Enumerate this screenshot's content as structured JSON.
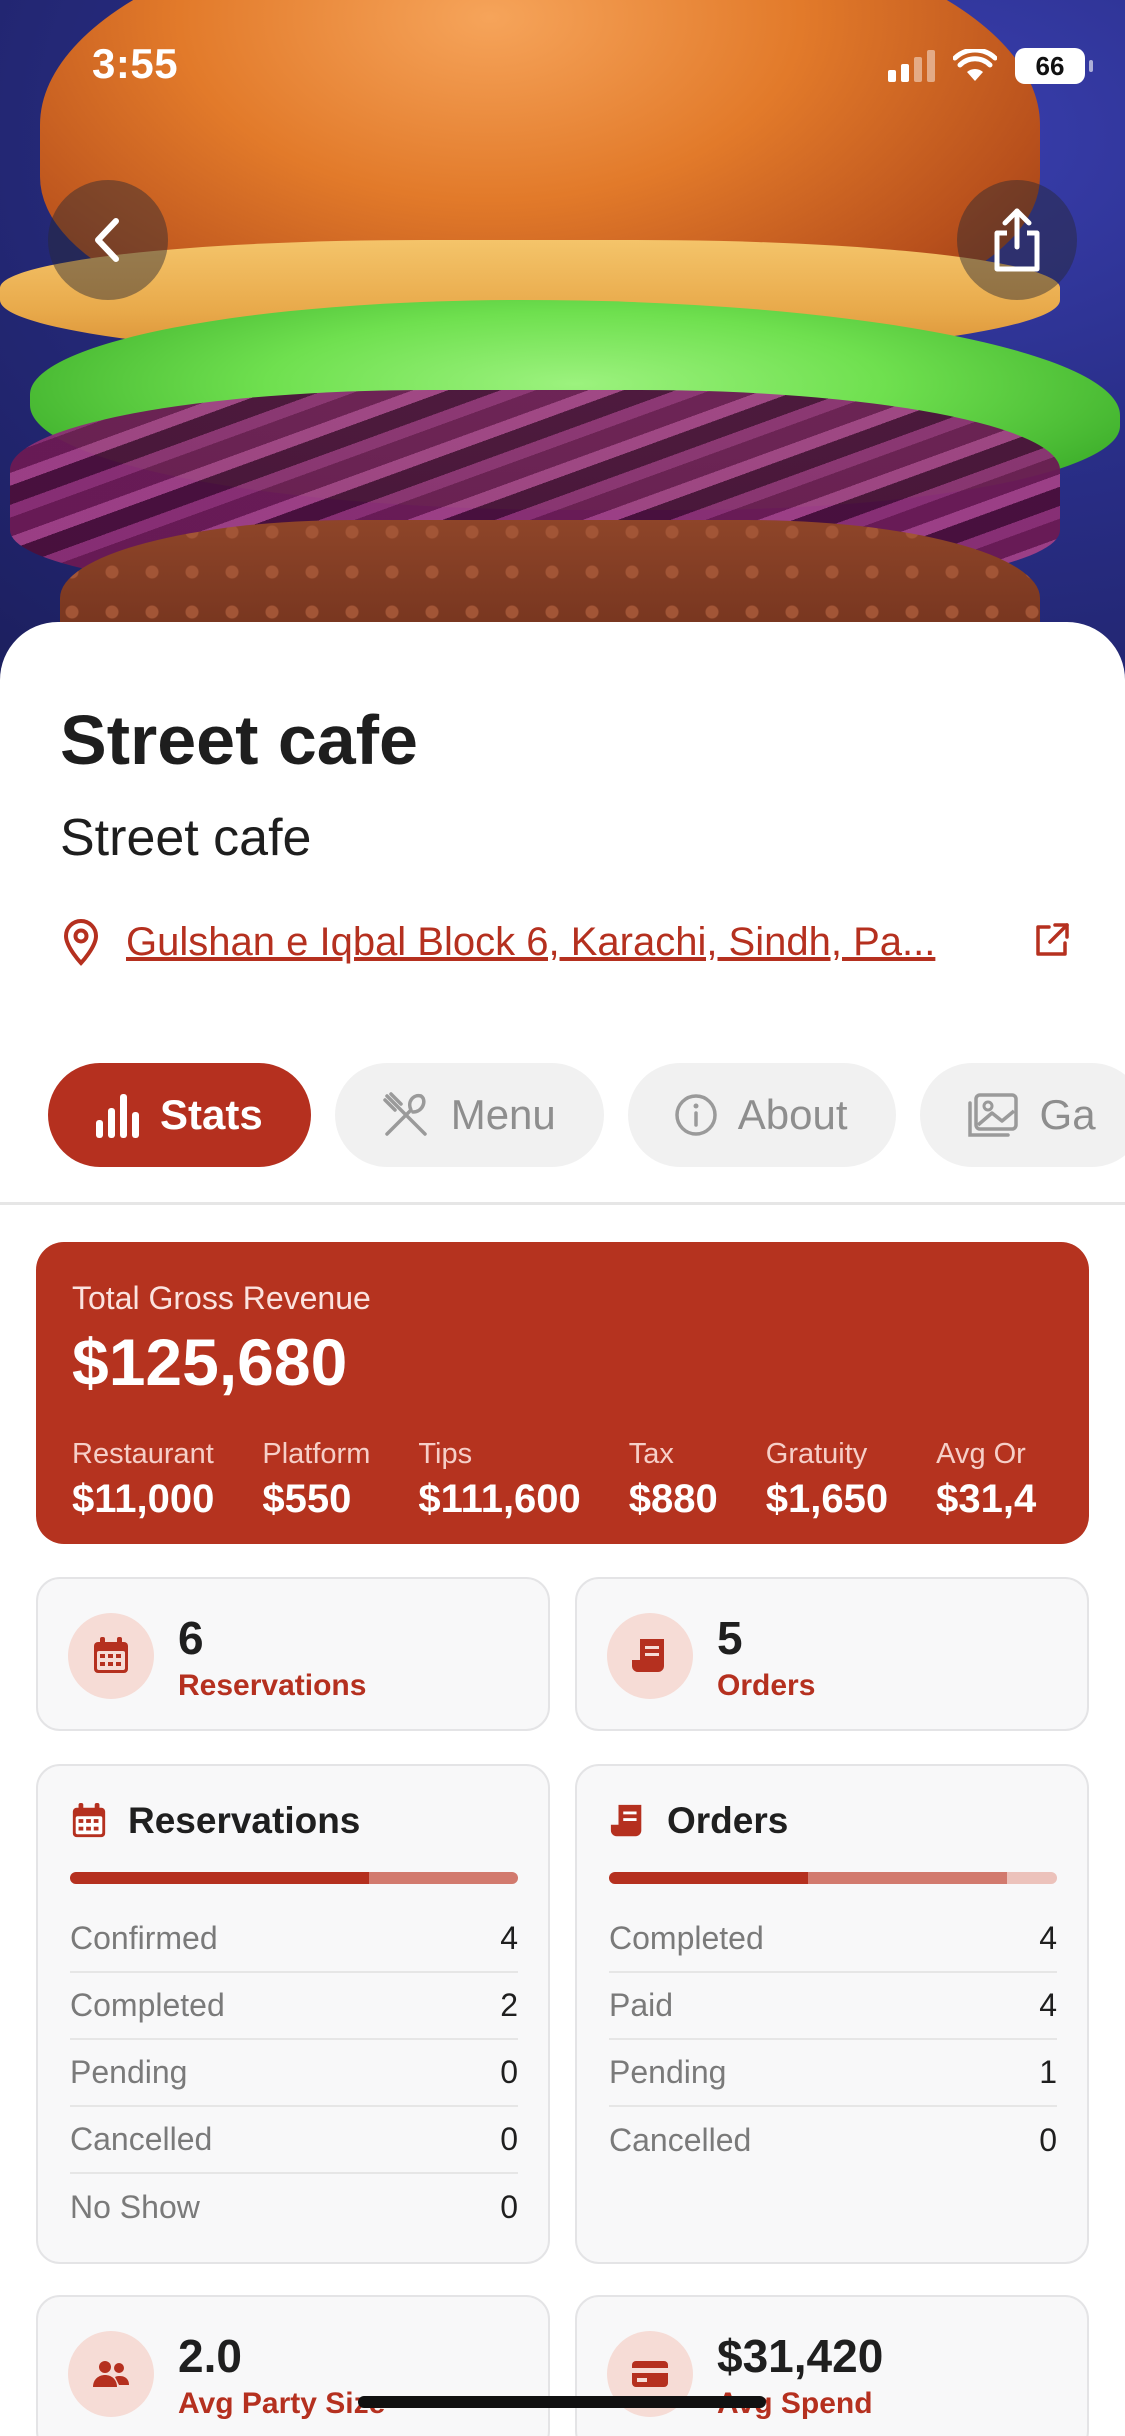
{
  "status_bar": {
    "time": "3:55",
    "battery": "66"
  },
  "header": {
    "back_icon": "chevron-left-icon",
    "share_icon": "share-icon"
  },
  "restaurant": {
    "name": "Street cafe",
    "subtitle": "Street cafe",
    "address": "Gulshan e Iqbal Block 6, Karachi, Sindh, Pa..."
  },
  "tabs": [
    {
      "label": "Stats",
      "icon": "bar-chart-icon",
      "active": true
    },
    {
      "label": "Menu",
      "icon": "utensils-icon",
      "active": false
    },
    {
      "label": "About",
      "icon": "info-icon",
      "active": false
    },
    {
      "label": "Ga",
      "icon": "gallery-icon",
      "active": false
    }
  ],
  "revenue": {
    "label": "Total Gross Revenue",
    "total": "$125,680",
    "items": [
      {
        "label": "Restaurant",
        "value": "$11,000"
      },
      {
        "label": "Platform",
        "value": "$550"
      },
      {
        "label": "Tips",
        "value": "$111,600"
      },
      {
        "label": "Tax",
        "value": "$880"
      },
      {
        "label": "Gratuity",
        "value": "$1,650"
      },
      {
        "label": "Avg Or",
        "value": "$31,4"
      }
    ]
  },
  "counts": {
    "reservations": {
      "value": "6",
      "label": "Reservations"
    },
    "orders": {
      "value": "5",
      "label": "Orders"
    }
  },
  "reservations_breakdown": {
    "title": "Reservations",
    "rows": [
      {
        "label": "Confirmed",
        "value": "4"
      },
      {
        "label": "Completed",
        "value": "2"
      },
      {
        "label": "Pending",
        "value": "0"
      },
      {
        "label": "Cancelled",
        "value": "0"
      },
      {
        "label": "No Show",
        "value": "0"
      }
    ]
  },
  "orders_breakdown": {
    "title": "Orders",
    "rows": [
      {
        "label": "Completed",
        "value": "4"
      },
      {
        "label": "Paid",
        "value": "4"
      },
      {
        "label": "Pending",
        "value": "1"
      },
      {
        "label": "Cancelled",
        "value": "0"
      }
    ]
  },
  "bottom": {
    "party": {
      "value": "2.0",
      "label": "Avg Party Size"
    },
    "spend": {
      "value": "$31,420",
      "label": "Avg Spend"
    }
  },
  "colors": {
    "accent": "#b5301f",
    "accent_light": "#d27a6e",
    "accent_pale": "#ecc2bb"
  }
}
